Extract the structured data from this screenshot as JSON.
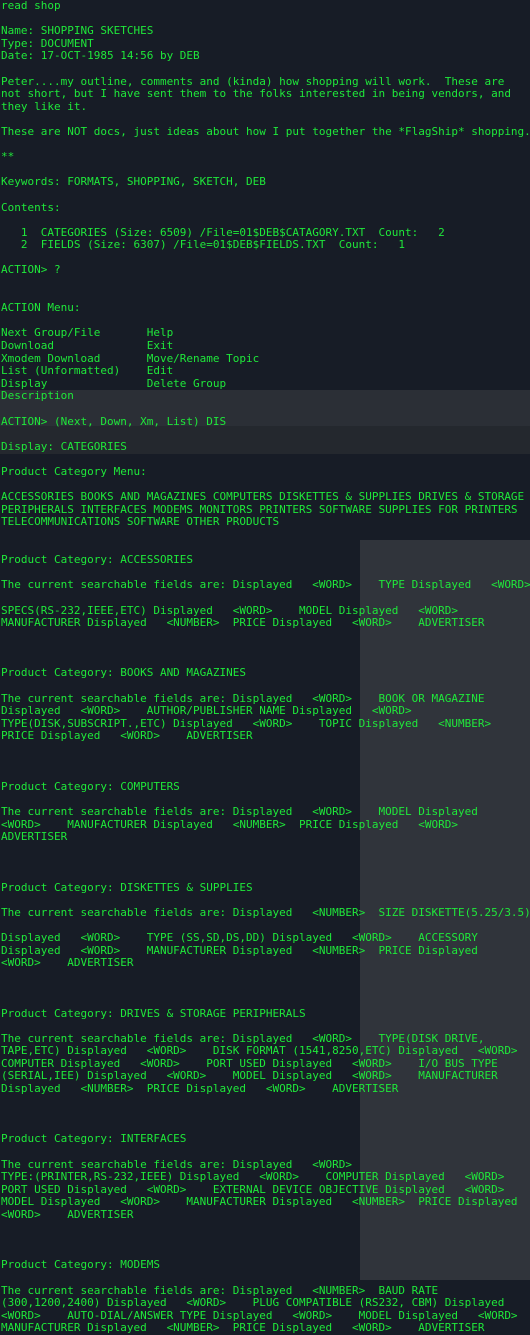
{
  "terminal": {
    "prompt_cmd": "read shop",
    "item": {
      "name_line": "Name: SHOPPING SKETCHES",
      "type_line": "Type: DOCUMENT",
      "date_line": "Date: 17-OCT-1985 14:56 by DEB"
    },
    "intro": [
      "Peter....my outline, comments and (kinda) how shopping will work.  These are",
      "not short, but I have sent them to the folks interested in being vendors, and",
      "they like it."
    ],
    "note": "These are NOT docs, just ideas about how I put together the *FlagShip* shopping.",
    "stars": "**",
    "keywords": "Keywords: FORMATS, SHOPPING, SKETCH, DEB",
    "contents_label": "Contents:",
    "contents": [
      "   1  CATEGORIES (Size: 6509) /File=01$DEB$CATAGORY.TXT  Count:   2",
      "   2  FIELDS (Size: 6307) /File=01$DEB$FIELDS.TXT  Count:   1"
    ],
    "action_prompt": "ACTION> ?",
    "menu_title": "ACTION Menu:",
    "menu_rows": [
      "Next Group/File       Help",
      "Download              Exit",
      "Xmodem Download       Move/Rename Topic",
      "List (Unformatted)    Edit",
      "Display               Delete Group",
      "Description"
    ],
    "action_cmd": "ACTION> (Next, Down, Xm, List) DIS",
    "display_line": "Display: CATEGORIES",
    "category_menu_title": "Product Category Menu:",
    "category_menu": [
      "ACCESSORIES BOOKS AND MAGAZINES COMPUTERS DISKETTES & SUPPLIES DRIVES & STORAGE",
      "PERIPHERALS INTERFACES MODEMS MONITORS PRINTERS SOFTWARE SUPPLIES FOR PRINTERS",
      "TELECOMMUNICATIONS SOFTWARE OTHER PRODUCTS"
    ],
    "categories": [
      {
        "title": "Product Category: ACCESSORIES",
        "lines": [
          "The current searchable fields are: Displayed   <WORD>    TYPE Displayed   <WORD>",
          "",
          "SPECS(RS-232,IEEE,ETC) Displayed   <WORD>    MODEL Displayed   <WORD>",
          "MANUFACTURER Displayed   <NUMBER>  PRICE Displayed   <WORD>    ADVERTISER"
        ]
      },
      {
        "title": "Product Category: BOOKS AND MAGAZINES",
        "lines": [
          "The current searchable fields are: Displayed   <WORD>    BOOK OR MAGAZINE",
          "Displayed   <WORD>    AUTHOR/PUBLISHER NAME Displayed   <WORD>",
          "TYPE(DISK,SUBSCRIPT.,ETC) Displayed   <WORD>    TOPIC Displayed   <NUMBER>",
          "PRICE Displayed   <WORD>    ADVERTISER"
        ]
      },
      {
        "title": "Product Category: COMPUTERS",
        "lines": [
          "The current searchable fields are: Displayed   <WORD>    MODEL Displayed",
          "<WORD>    MANUFACTURER Displayed   <NUMBER>  PRICE Displayed   <WORD>",
          "ADVERTISER"
        ]
      },
      {
        "title": "Product Category: DISKETTES & SUPPLIES",
        "lines": [
          "The current searchable fields are: Displayed   <NUMBER>  SIZE DISKETTE(5.25/3.5)",
          "",
          "Displayed   <WORD>    TYPE (SS,SD,DS,DD) Displayed   <WORD>    ACCESSORY",
          "Displayed   <WORD>    MANUFACTURER Displayed   <NUMBER>  PRICE Displayed",
          "<WORD>    ADVERTISER"
        ]
      },
      {
        "title": "Product Category: DRIVES & STORAGE PERIPHERALS",
        "lines": [
          "The current searchable fields are: Displayed   <WORD>    TYPE(DISK DRIVE,",
          "TAPE,ETC) Displayed   <WORD>    DISK FORMAT (1541,8250,ETC) Displayed   <WORD>",
          "COMPUTER Displayed   <WORD>    PORT USED Displayed   <WORD>    I/O BUS TYPE",
          "(SERIAL,IEE) Displayed   <WORD>    MODEL Displayed   <WORD>    MANUFACTURER",
          "Displayed   <NUMBER>  PRICE Displayed   <WORD>    ADVERTISER"
        ]
      },
      {
        "title": "Product Category: INTERFACES",
        "lines": [
          "The current searchable fields are: Displayed   <WORD>",
          "TYPE:(PRINTER,RS-232,IEEE) Displayed   <WORD>    COMPUTER Displayed   <WORD>",
          "PORT USED Displayed   <WORD>    EXTERNAL DEVICE OBJECTIVE Displayed   <WORD>",
          "MODEL Displayed   <WORD>    MANUFACTURER Displayed   <NUMBER>  PRICE Displayed",
          "<WORD>    ADVERTISER"
        ]
      },
      {
        "title": "Product Category: MODEMS",
        "lines": [
          "The current searchable fields are: Displayed   <NUMBER>  BAUD RATE",
          "(300,1200,2400) Displayed   <WORD>    PLUG COMPATIBLE (RS232, CBM) Displayed",
          "<WORD>    AUTO-DIAL/ANSWER TYPE Displayed   <WORD>    MODEL Displayed   <WORD>",
          "MANUFACTURER Displayed   <NUMBER>  PRICE Displayed   <WORD>    ADVERTISER"
        ]
      }
    ]
  }
}
